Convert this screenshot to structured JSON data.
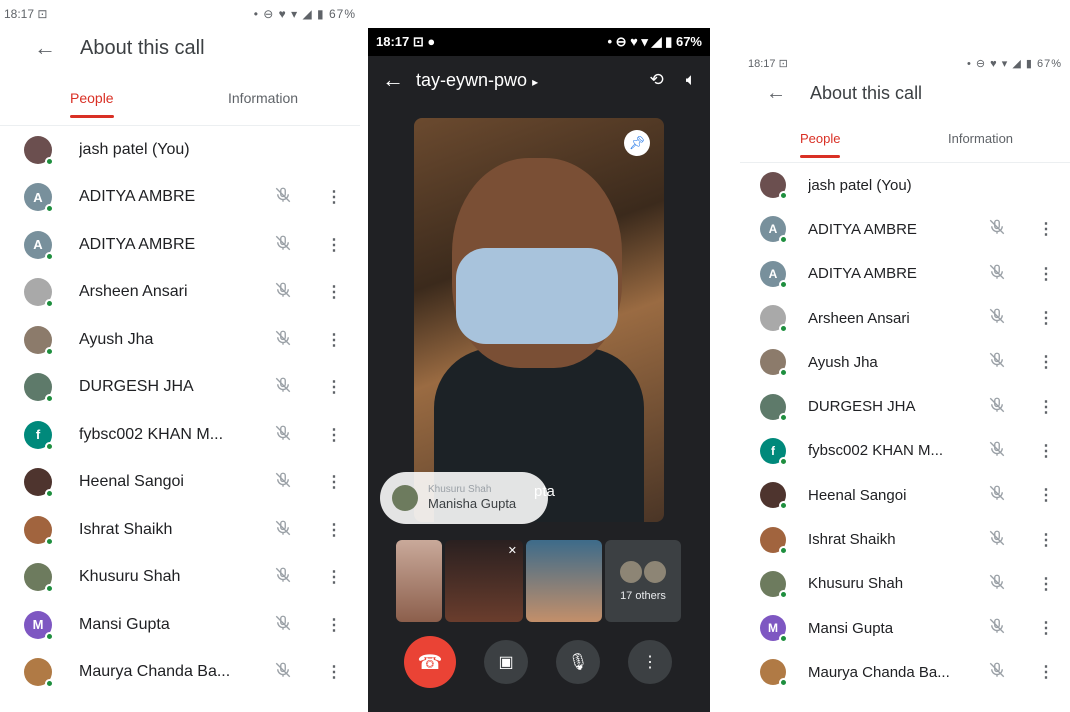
{
  "status": {
    "time": "18:17",
    "battery": "67%",
    "left_glyph": "⊡",
    "icons_glyph": "• ⊖ ♥ ▾ ◢ ▮"
  },
  "about_call": {
    "title": "About this call",
    "tabs": {
      "people": "People",
      "information": "Information"
    },
    "people": [
      {
        "name": "jash patel (You)",
        "initial": "",
        "color": "#6b4f4f",
        "you": true
      },
      {
        "name": "ADITYA AMBRE",
        "initial": "A",
        "color": "#78909c",
        "you": false
      },
      {
        "name": "ADITYA AMBRE",
        "initial": "A",
        "color": "#78909c",
        "you": false
      },
      {
        "name": "Arsheen Ansari",
        "initial": "",
        "color": "#a9a9a9",
        "you": false
      },
      {
        "name": "Ayush Jha",
        "initial": "",
        "color": "#8c7b6b",
        "you": false
      },
      {
        "name": "DURGESH JHA",
        "initial": "",
        "color": "#5e7a6a",
        "you": false
      },
      {
        "name": "fybsc002 KHAN M...",
        "initial": "f",
        "color": "#00897b",
        "you": false
      },
      {
        "name": "Heenal Sangoi",
        "initial": "",
        "color": "#4e342e",
        "you": false
      },
      {
        "name": "Ishrat Shaikh",
        "initial": "",
        "color": "#a1643e",
        "you": false
      },
      {
        "name": "Khusuru Shah",
        "initial": "",
        "color": "#6d7b5e",
        "you": false
      },
      {
        "name": "Mansi Gupta",
        "initial": "M",
        "color": "#7e57c2",
        "you": false
      },
      {
        "name": "Maurya Chanda Ba...",
        "initial": "",
        "color": "#b07a45",
        "you": false
      }
    ]
  },
  "call": {
    "meeting_code": "tay-eywn-pwo",
    "code_caret": "▸",
    "main_participant_partial": "pta",
    "speaker_toast": {
      "subtitle": "Khusuru Shah",
      "name": "Manisha Gupta"
    },
    "others_label": "17 others"
  },
  "colors": {
    "accent": "#d93025",
    "end_call": "#ea4335",
    "online": "#1e8e3e",
    "call_bg": "#202124"
  }
}
